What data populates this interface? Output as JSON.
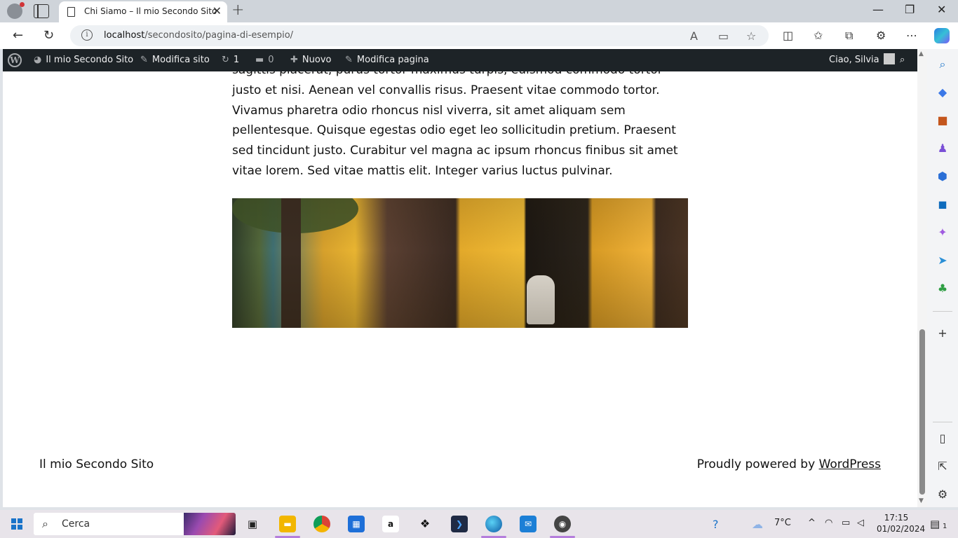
{
  "browser": {
    "tab_title": "Chi Siamo – Il mio Secondo Sito",
    "new_tab_symbol": "+",
    "url_host": "localhost",
    "url_path": "/secondosito/pagina-di-esempio/"
  },
  "wp_admin_bar": {
    "site_name": "Il mio Secondo Sito",
    "customize": "Modifica sito",
    "updates_count": "1",
    "comments_count": "0",
    "new": "Nuovo",
    "edit_page": "Modifica pagina",
    "greeting": "Ciao, Silvia"
  },
  "article": {
    "paragraph": "sagittis placerat, purus tortor maximus turpis, euismod commodo tortor justo et nisi. Aenean vel convallis risus. Praesent vitae commodo tortor. Vivamus pharetra odio rhoncus nisl viverra, sit amet aliquam sem pellentesque. Quisque egestas odio eget leo sollicitudin pretium. Praesent sed tincidunt justo. Curabitur vel magna ac ipsum rhoncus finibus sit amet vitae lorem. Sed vitae mattis elit. Integer varius luctus pulvinar."
  },
  "footer": {
    "site_title": "Il mio Secondo Sito",
    "powered_prefix": "Proudly powered by ",
    "powered_link": "WordPress"
  },
  "taskbar": {
    "search_placeholder": "Cerca",
    "weather": "7°C",
    "time": "17:15",
    "date": "01/02/2024",
    "amazon_label": "a",
    "notification_count": "1"
  },
  "colors": {
    "wp_admin_bar": "#1d2327",
    "accent": "#1a73c9"
  }
}
